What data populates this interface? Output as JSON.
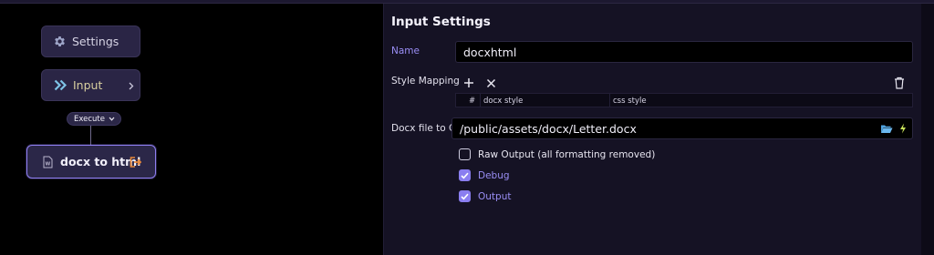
{
  "canvas": {
    "nodes": {
      "settings": {
        "label": "Settings",
        "icon": "gear-icon"
      },
      "input": {
        "label": "Input",
        "icon": "double-chevron-right-icon"
      },
      "docx": {
        "label": "docx to html",
        "icon": "word-document-icon",
        "output_icon": "output-arrow-icon"
      }
    },
    "execute": {
      "label": "Execute"
    }
  },
  "panel": {
    "title": "Input Settings",
    "name": {
      "label": "Name",
      "value": "docxhtml"
    },
    "style_mapping": {
      "label": "Style Mapping",
      "columns": [
        "#",
        "docx style",
        "css style"
      ]
    },
    "docx_file": {
      "label": "Docx file to Convert",
      "value": "/public/assets/docx/Letter.docx"
    },
    "options": [
      {
        "label": "Raw Output (all formatting removed)",
        "checked": false
      },
      {
        "label": "Debug",
        "checked": true
      },
      {
        "label": "Output",
        "checked": true
      }
    ]
  },
  "colors": {
    "accent": "#8a7ef0",
    "accent_text": "#9a8ef5",
    "input_node_text": "#d9d0a0",
    "folder_icon": "#4fa3e0",
    "bolt_icon": "#c8e25a",
    "output_icon": "#e8893a"
  }
}
